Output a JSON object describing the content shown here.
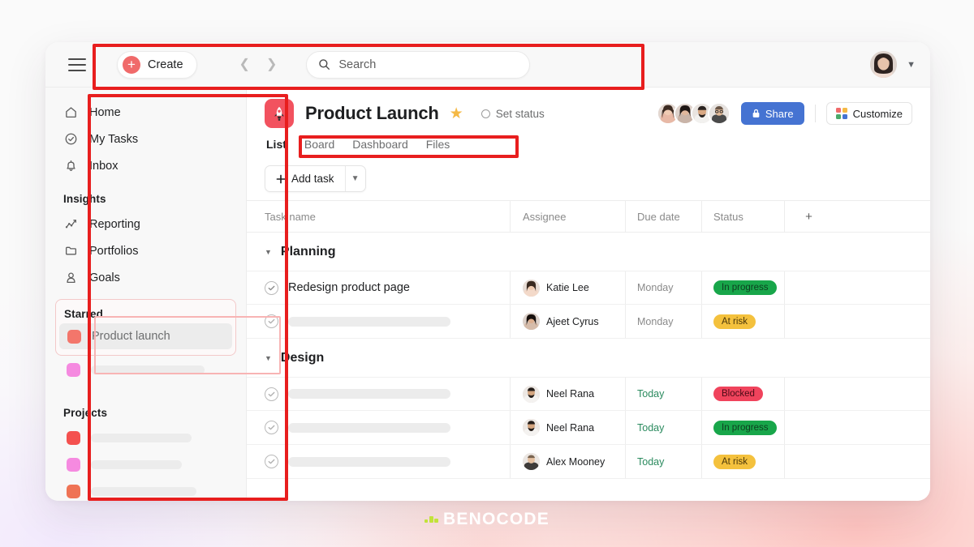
{
  "topbar": {
    "menu_icon": "hamburger-icon",
    "create_label": "Create",
    "back_icon": "chevron-left-icon",
    "forward_icon": "chevron-right-icon",
    "search_icon": "search-icon",
    "search_placeholder": "Search",
    "search_value": "",
    "account_chevron_icon": "chevron-down-icon"
  },
  "sidebar": {
    "nav": [
      {
        "label": "Home",
        "icon": "home-icon"
      },
      {
        "label": "My Tasks",
        "icon": "check-circle-icon"
      },
      {
        "label": "Inbox",
        "icon": "bell-icon"
      }
    ],
    "insights_title": "Insights",
    "insights": [
      {
        "label": "Reporting",
        "icon": "line-chart-icon"
      },
      {
        "label": "Portfolios",
        "icon": "folder-icon"
      },
      {
        "label": "Goals",
        "icon": "goal-person-icon"
      }
    ],
    "starred_title": "Starred",
    "starred": [
      {
        "label": "Product launch",
        "color": "#f3766b"
      },
      {
        "label": "",
        "color": "#f58ae0"
      }
    ],
    "projects_title": "Projects",
    "projects": [
      {
        "label": "",
        "color": "#f4514f"
      },
      {
        "label": "",
        "color": "#f58ae0"
      },
      {
        "label": "",
        "color": "#ef7355"
      }
    ]
  },
  "project": {
    "icon": "rocket-icon",
    "icon_color": "#f2525f",
    "title": "Product Launch",
    "star_icon": "star-icon",
    "star_color": "#f5b945",
    "set_status_label": "Set status",
    "share_label": "Share",
    "share_icon": "lock-icon",
    "share_color": "#4573d2",
    "customize_label": "Customize",
    "customize_icon": "grid-icon",
    "members_count": 4,
    "tabs": [
      {
        "label": "List",
        "active": true
      },
      {
        "label": "Board",
        "active": false
      },
      {
        "label": "Dashboard",
        "active": false
      },
      {
        "label": "Files",
        "active": false
      }
    ]
  },
  "toolbar": {
    "add_task_label": "Add task",
    "add_task_icon": "plus-icon",
    "add_task_caret_icon": "chevron-down-icon"
  },
  "table": {
    "columns": [
      "Task name",
      "Assignee",
      "Due date",
      "Status"
    ],
    "add_column_icon": "plus-icon",
    "groups": [
      {
        "name": "Planning",
        "caret_icon": "caret-down-icon",
        "rows": [
          {
            "task": "Redesign product page",
            "redacted": false,
            "assignee": "Katie Lee",
            "avatar_tone": "#e6cdbf",
            "due": "Monday",
            "due_tone": "gray",
            "status": "In progress",
            "status_bg": "#18a64a",
            "status_fg": "#0d3d1f"
          },
          {
            "task": "",
            "redacted": true,
            "assignee": "Ajeet Cyrus",
            "avatar_tone": "#d9c3b4",
            "due": "Monday",
            "due_tone": "gray",
            "status": "At risk",
            "status_bg": "#f4c13d",
            "status_fg": "#4a3608"
          }
        ]
      },
      {
        "name": "Design",
        "caret_icon": "caret-down-icon",
        "rows": [
          {
            "task": "",
            "redacted": true,
            "assignee": "Neel Rana",
            "avatar_tone": "#c9b4a4",
            "due": "Today",
            "due_tone": "green",
            "status": "Blocked",
            "status_bg": "#f0435c",
            "status_fg": "#4a0b16"
          },
          {
            "task": "",
            "redacted": true,
            "assignee": "Neel Rana",
            "avatar_tone": "#c9b4a4",
            "due": "Today",
            "due_tone": "green",
            "status": "In progress",
            "status_bg": "#18a64a",
            "status_fg": "#0d3d1f"
          },
          {
            "task": "",
            "redacted": true,
            "assignee": "Alex Mooney",
            "avatar_tone": "#dccfc6",
            "due": "Today",
            "due_tone": "green",
            "status": "At risk",
            "status_bg": "#f4c13d",
            "status_fg": "#4a3608"
          }
        ]
      }
    ]
  },
  "watermark": {
    "text": "BENOCODE",
    "mark_color": "#c2e33a"
  }
}
